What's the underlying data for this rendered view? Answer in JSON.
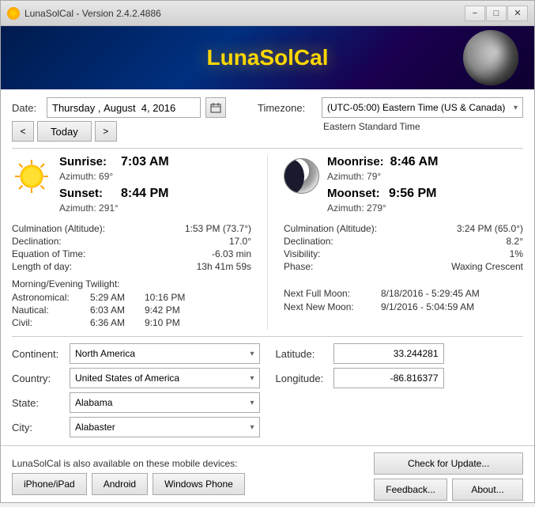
{
  "window": {
    "title": "LunaSolCal - Version 2.4.2.4886",
    "minimize": "−",
    "restore": "□",
    "close": "✕"
  },
  "header": {
    "title": "LunaSolCal"
  },
  "date": {
    "label": "Date:",
    "day": "Thursday",
    "separator": ",",
    "month": "August",
    "day_num": "4,",
    "year": "2016",
    "prev": "<",
    "today": "Today",
    "next": ">"
  },
  "timezone": {
    "label": "Timezone:",
    "value": "(UTC-05:00) Eastern Time (US & Canada)",
    "standard": "Eastern Standard Time"
  },
  "sun": {
    "sunrise_label": "Sunrise:",
    "sunrise_time": "7:03 AM",
    "sunrise_azimuth_label": "Azimuth:",
    "sunrise_azimuth": "69°",
    "sunset_label": "Sunset:",
    "sunset_time": "8:44 PM",
    "sunset_azimuth_label": "Azimuth:",
    "sunset_azimuth": "291°",
    "culmination_label": "Culmination (Altitude):",
    "culmination_value": "1:53 PM (73.7°)",
    "declination_label": "Declination:",
    "declination_value": "17.0°",
    "equation_label": "Equation of Time:",
    "equation_value": "-6.03 min",
    "length_label": "Length of day:",
    "length_value": "13h 41m 59s",
    "twilight_header": "Morning/Evening Twilight:",
    "astronomical_label": "Astronomical:",
    "astronomical_morning": "5:29 AM",
    "astronomical_evening": "10:16 PM",
    "nautical_label": "Nautical:",
    "nautical_morning": "6:03 AM",
    "nautical_evening": "9:42 PM",
    "civil_label": "Civil:",
    "civil_morning": "6:36 AM",
    "civil_evening": "9:10 PM"
  },
  "moon": {
    "moonrise_label": "Moonrise:",
    "moonrise_time": "8:46 AM",
    "moonrise_azimuth_label": "Azimuth:",
    "moonrise_azimuth": "79°",
    "moonset_label": "Moonset:",
    "moonset_time": "9:56 PM",
    "moonset_azimuth_label": "Azimuth:",
    "moonset_azimuth": "279°",
    "culmination_label": "Culmination (Altitude):",
    "culmination_value": "3:24 PM (65.0°)",
    "declination_label": "Declination:",
    "declination_value": "8.2°",
    "visibility_label": "Visibility:",
    "visibility_value": "1%",
    "phase_label": "Phase:",
    "phase_value": "Waxing Crescent",
    "next_full_label": "Next Full Moon:",
    "next_full_value": "8/18/2016 - 5:29:45 AM",
    "next_new_label": "Next New Moon:",
    "next_new_value": "9/1/2016 - 5:04:59 AM"
  },
  "location": {
    "continent_label": "Continent:",
    "continent_value": "North America",
    "country_label": "Country:",
    "country_value": "United States of America",
    "state_label": "State:",
    "state_value": "Alabama",
    "city_label": "City:",
    "city_value": "Alabaster",
    "latitude_label": "Latitude:",
    "latitude_value": "33.244281",
    "longitude_label": "Longitude:",
    "longitude_value": "-86.816377"
  },
  "footer": {
    "mobile_label": "LunaSolCal is also available on these mobile devices:",
    "iphone_btn": "iPhone/iPad",
    "android_btn": "Android",
    "windows_phone_btn": "Windows Phone",
    "check_update_btn": "Check for Update...",
    "feedback_btn": "Feedback...",
    "about_btn": "About..."
  }
}
